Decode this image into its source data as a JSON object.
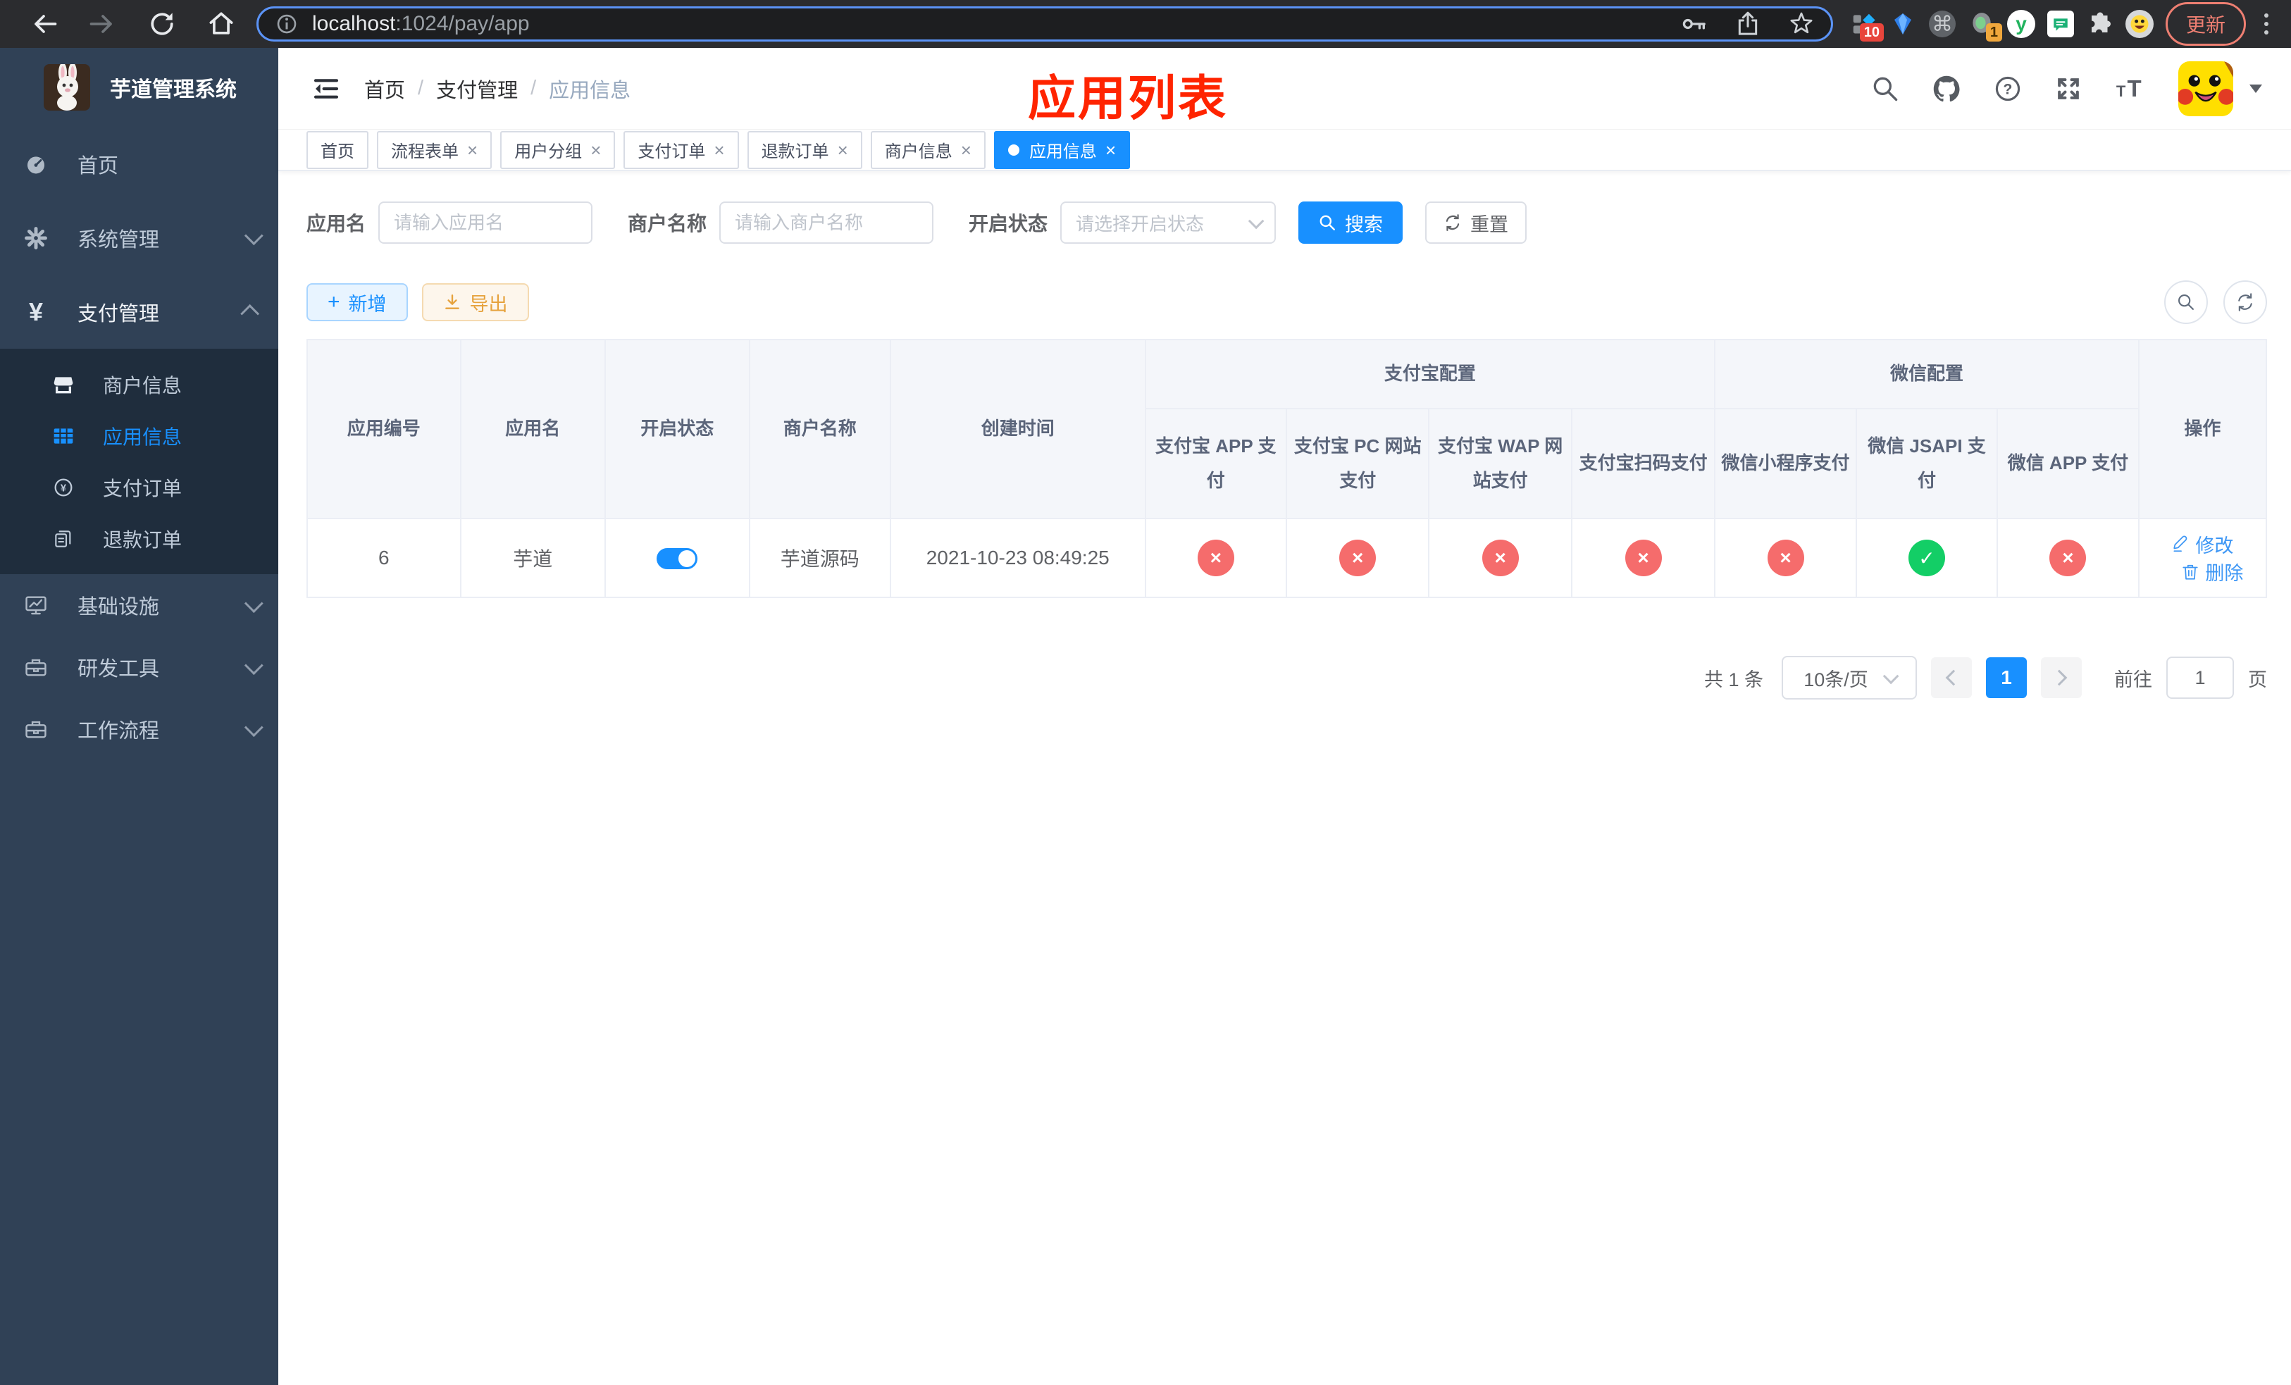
{
  "colors": {
    "primary": "#1890ff",
    "success": "#13ce66",
    "danger": "#f56c6c",
    "warning": "#e6a23c",
    "sidebar_bg": "#304156",
    "submenu_bg": "#1f2d3d",
    "annotation_red": "#ff2400"
  },
  "browser": {
    "url_host": "localhost",
    "url_path": ":1024/pay/app",
    "ext_badge_count": "10",
    "ext_badge_one": "1",
    "update_label": "更新"
  },
  "sidebar": {
    "title": "芋道管理系统",
    "items": [
      {
        "label": "首页"
      },
      {
        "label": "系统管理"
      },
      {
        "label": "支付管理"
      },
      {
        "label": "基础设施"
      },
      {
        "label": "研发工具"
      },
      {
        "label": "工作流程"
      }
    ],
    "submenu": [
      {
        "label": "商户信息"
      },
      {
        "label": "应用信息"
      },
      {
        "label": "支付订单"
      },
      {
        "label": "退款订单"
      }
    ]
  },
  "header": {
    "breadcrumb": [
      "首页",
      "支付管理",
      "应用信息"
    ],
    "annotation": "应用列表"
  },
  "tabs": [
    {
      "label": "首页"
    },
    {
      "label": "流程表单"
    },
    {
      "label": "用户分组"
    },
    {
      "label": "支付订单"
    },
    {
      "label": "退款订单"
    },
    {
      "label": "商户信息"
    },
    {
      "label": "应用信息"
    }
  ],
  "filters": {
    "app_name_label": "应用名",
    "app_name_placeholder": "请输入应用名",
    "merchant_label": "商户名称",
    "merchant_placeholder": "请输入商户名称",
    "status_label": "开启状态",
    "status_placeholder": "请选择开启状态",
    "search_label": "搜索",
    "reset_label": "重置"
  },
  "toolbar": {
    "add_label": "新增",
    "export_label": "导出"
  },
  "table": {
    "columns": {
      "app_id": "应用编号",
      "app_name": "应用名",
      "status": "开启状态",
      "merchant": "商户名称",
      "created": "创建时间",
      "alipay_group": "支付宝配置",
      "wechat_group": "微信配置",
      "actions": "操作"
    },
    "sub_columns": [
      "支付宝 APP 支付",
      "支付宝 PC 网站支付",
      "支付宝 WAP 网站支付",
      "支付宝扫码支付",
      "微信小程序支付",
      "微信 JSAPI 支付",
      "微信 APP 支付"
    ],
    "row": {
      "id": "6",
      "name": "芋道",
      "enabled": true,
      "merchant": "芋道源码",
      "created": "2021-10-23 08:49:25",
      "channels": [
        false,
        false,
        false,
        false,
        false,
        true,
        false
      ],
      "edit_label": "修改",
      "delete_label": "删除"
    }
  },
  "pagination": {
    "total": "共 1 条",
    "page_size": "10条/页",
    "current_page": "1",
    "goto_label": "前往",
    "goto_value": "1",
    "page_unit": "页"
  }
}
